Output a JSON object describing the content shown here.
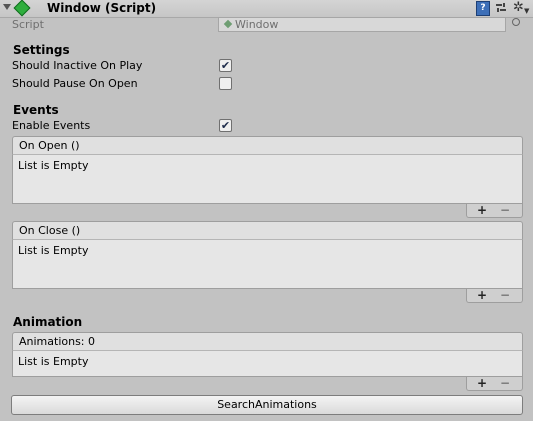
{
  "header": {
    "title": "Window (Script)",
    "help_glyph": "?",
    "gear_glyph": "✲"
  },
  "script_row": {
    "label": "Script",
    "value": "Window"
  },
  "settings": {
    "title": "Settings",
    "rows": [
      {
        "label": "Should Inactive On Play",
        "checked": true
      },
      {
        "label": "Should Pause On Open",
        "checked": false
      }
    ]
  },
  "events": {
    "title": "Events",
    "enable_label": "Enable Events",
    "enable_checked": true,
    "on_open": {
      "title": "On Open ()",
      "empty_text": "List is Empty"
    },
    "on_close": {
      "title": "On Close ()",
      "empty_text": "List is Empty"
    }
  },
  "animation": {
    "title": "Animation",
    "list_header": "Animations: 0",
    "empty_text": "List is Empty"
  },
  "footer_controls": {
    "plus": "+",
    "minus": "−"
  },
  "search_button": {
    "label": "SearchAnimations"
  },
  "checkmark": "✔"
}
